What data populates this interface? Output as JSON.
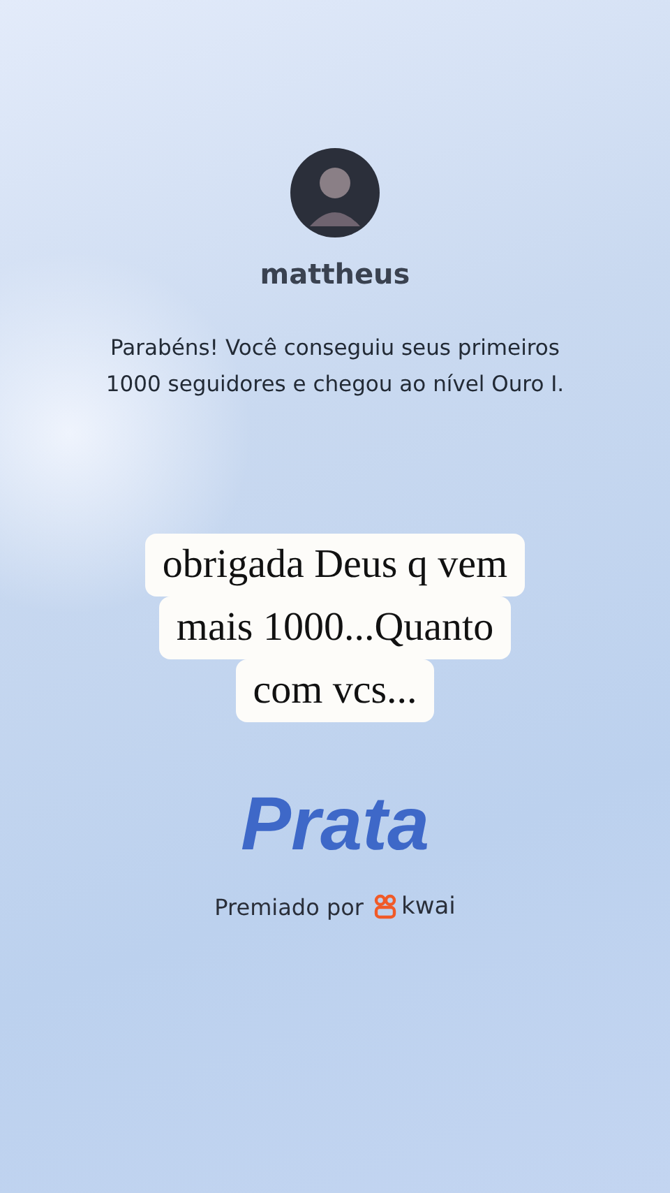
{
  "profile": {
    "username": "mattheus",
    "message": "Parabéns! Você conseguiu seus primeiros 1000 seguidores e chegou ao nível Ouro I."
  },
  "caption": {
    "lines": [
      "obrigada Deus q vem",
      "mais 1000...Quanto",
      "com vcs..."
    ]
  },
  "award": {
    "title": "Prata",
    "awarded_by": "Premiado por",
    "brand": "kwai"
  }
}
